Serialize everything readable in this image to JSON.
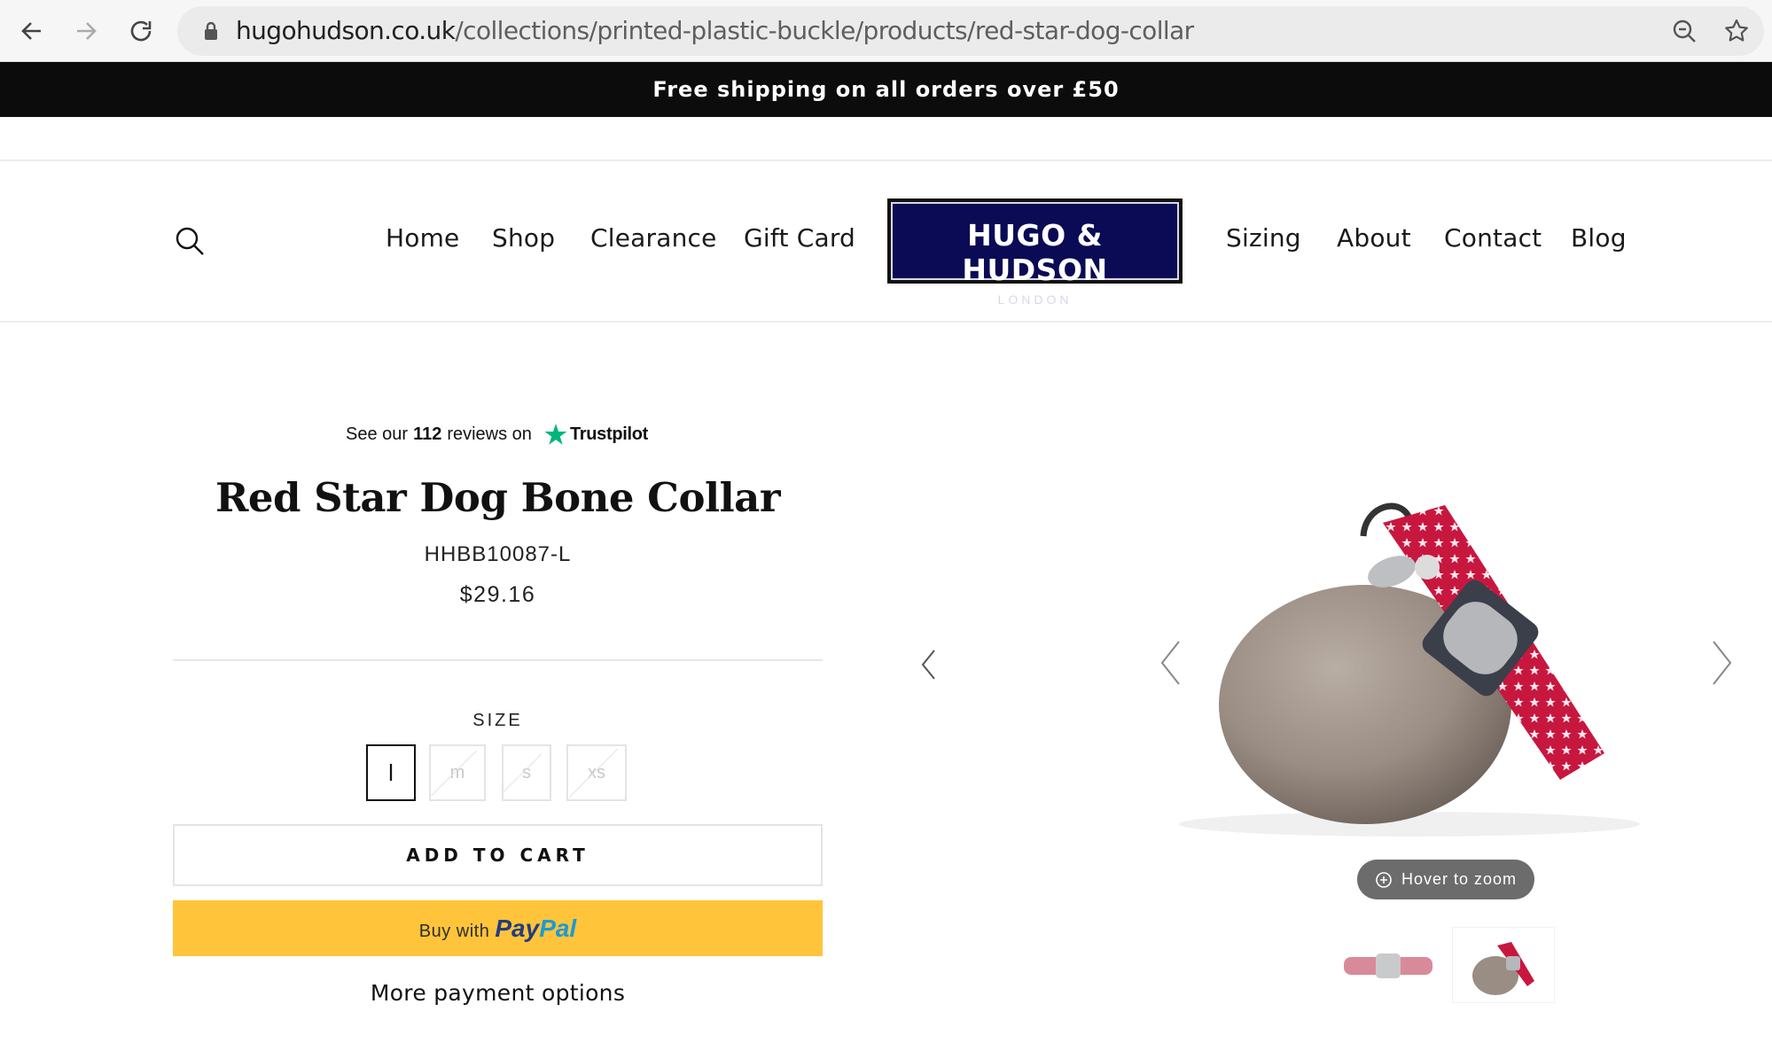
{
  "browser": {
    "url_host": "hugohudson.co.uk",
    "url_path": "/collections/printed-plastic-buckle/products/red-star-dog-collar"
  },
  "announcement": "Free shipping on all orders over £50",
  "nav": {
    "left": [
      "Home",
      "Shop",
      "Clearance",
      "Gift Card"
    ],
    "right": [
      "Sizing",
      "About",
      "Contact",
      "Blog"
    ]
  },
  "logo": {
    "name": "HUGO & HUDSON",
    "sub": "LONDON"
  },
  "trustpilot": {
    "prefix": "See our",
    "count": "112",
    "suffix": "reviews on",
    "brand": "Trustpilot"
  },
  "product": {
    "title": "Red Star Dog Bone Collar",
    "sku": "HHBB10087-L",
    "price": "$29.16",
    "size_label": "SIZE",
    "sizes": [
      {
        "label": "l",
        "available": true,
        "selected": true
      },
      {
        "label": "m",
        "available": false,
        "selected": false
      },
      {
        "label": "s",
        "available": false,
        "selected": false
      },
      {
        "label": "xs",
        "available": false,
        "selected": false
      }
    ],
    "add_to_cart": "ADD TO CART",
    "paypal": {
      "buy_with": "Buy with",
      "brand_a": "Pay",
      "brand_b": "Pal"
    },
    "more_payment": "More payment options"
  },
  "gallery": {
    "zoom_hint": "Hover to zoom"
  },
  "colors": {
    "announce_bg": "#0c0c0c",
    "logo_bg": "#0a0a55",
    "paypal_yellow": "#ffc439",
    "trustpilot_green": "#00b67a",
    "collar_red": "#c8173e"
  }
}
